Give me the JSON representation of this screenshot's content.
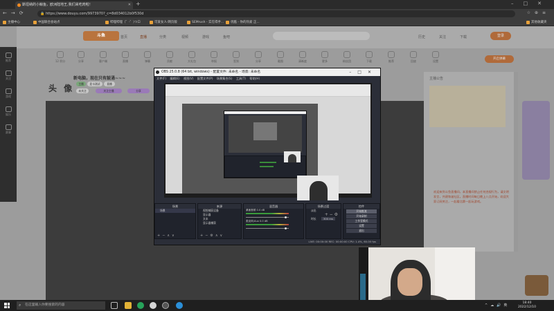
{
  "browser": {
    "tab_title": "斯坦纳的小鲸鱼，欧洲陆地王,我们来吃肉啦！",
    "url": "https://www.douyu.com/9973970?_c=8d034012b0f530d",
    "bookmarks": [
      "主播中心",
      "中国联合会站点",
      "哔哩哔哩（゜-゜)つロ",
      "可爱女人·网页版",
      "SEMrush - 实在得手...",
      "优酷 - 你的热爱 正..."
    ],
    "bookmark_right": "其他收藏夹"
  },
  "site": {
    "logo": "斗鱼",
    "nav": [
      "首页",
      "直播",
      "分类",
      "视频",
      "游戏",
      "鱼吧"
    ],
    "right_nav": [
      "历史",
      "关注",
      "下载"
    ],
    "login": "登录"
  },
  "sidebar": [
    "推荐",
    "关注",
    "游戏",
    "娱乐",
    "赛事"
  ],
  "categories": [
    "12 积分",
    "分享",
    "客户端",
    "直播",
    "弹幕",
    "贡献",
    "大礼包",
    "举报",
    "签到",
    "分享",
    "截图",
    "清晰度",
    "更多",
    "粉丝团",
    "下载",
    "推荐",
    "回放",
    "设置"
  ],
  "watch_button": "开启弹幕",
  "room": {
    "number": "12",
    "title": "新电脑，现在只有鼓涌~~~",
    "name": "头 像",
    "tags": [
      "主播",
      "显卡测试",
      "直播",
      "未关注",
      "关注主播",
      "分享"
    ]
  },
  "right_panel": {
    "header": "主播公告",
    "text": "欢迎来到斗鱼直播间，本直播间禁止任何违规行为，请文明发言，共建和谐社区。直播时间每日晚上八点开始，欢迎大家订阅关注，一起看比赛一起玩游戏。"
  },
  "obs": {
    "title": "OBS 25.0.8 (64 bit, windows) - 配置文件: 未命名 - 场景: 未命名",
    "menu": [
      "文件(F)",
      "编辑(E)",
      "视图(V)",
      "配置文件(P)",
      "场景集合(S)",
      "工具(T)",
      "帮助(H)"
    ],
    "docks": {
      "scenes": {
        "title": "场景",
        "items": [
          "场景"
        ]
      },
      "sources": {
        "title": "来源",
        "items": [
          "视频捕获设备",
          "显示器",
          "文本",
          "显示器捕获"
        ]
      },
      "mixer": {
        "title": "混音器",
        "items": [
          "桌面音频 0.0 dB",
          "麦克风/Aux 0.0 dB"
        ]
      },
      "transitions": {
        "title": "场景过渡",
        "fade": "淡出",
        "duration_label": "时长",
        "duration": "300 ms"
      },
      "controls": {
        "title": "控件",
        "buttons": [
          "开始推流",
          "开始录制",
          "工作室模式",
          "设置",
          "退出"
        ]
      }
    },
    "status": "LIVE: 00:00:00   REC: 00:00:00   CPU: 1.4%, 60.00 fps"
  },
  "taskbar": {
    "search_placeholder": "在这里输入你要搜索的内容",
    "time": "18:40",
    "date": "2022/12/10"
  }
}
